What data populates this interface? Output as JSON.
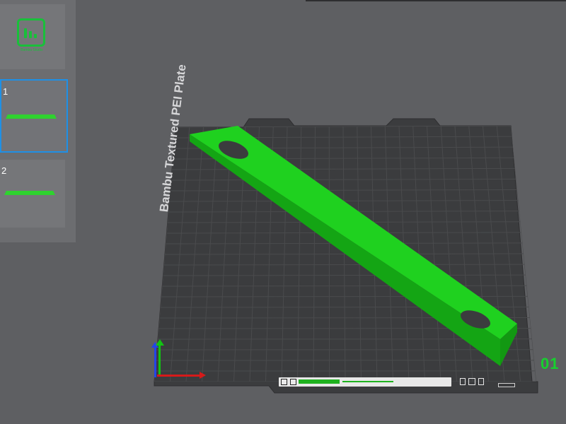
{
  "plate_list": {
    "logo_caption": "Bambu Studio",
    "plates": [
      {
        "number": "1"
      },
      {
        "number": "2"
      }
    ]
  },
  "canvas": {
    "bed_label": "Bambu Textured PEI Plate",
    "plate_number": "01"
  },
  "colors": {
    "accent": "#19c03a",
    "selection": "#1e90e6",
    "model": "#1fd11f",
    "bed": "#3a3b3d",
    "background": "#5e5f62"
  },
  "icons": [
    "bambu-logo-icon",
    "axis-x-icon",
    "axis-y-icon",
    "axis-z-icon",
    "delete-icon",
    "square-icon"
  ]
}
